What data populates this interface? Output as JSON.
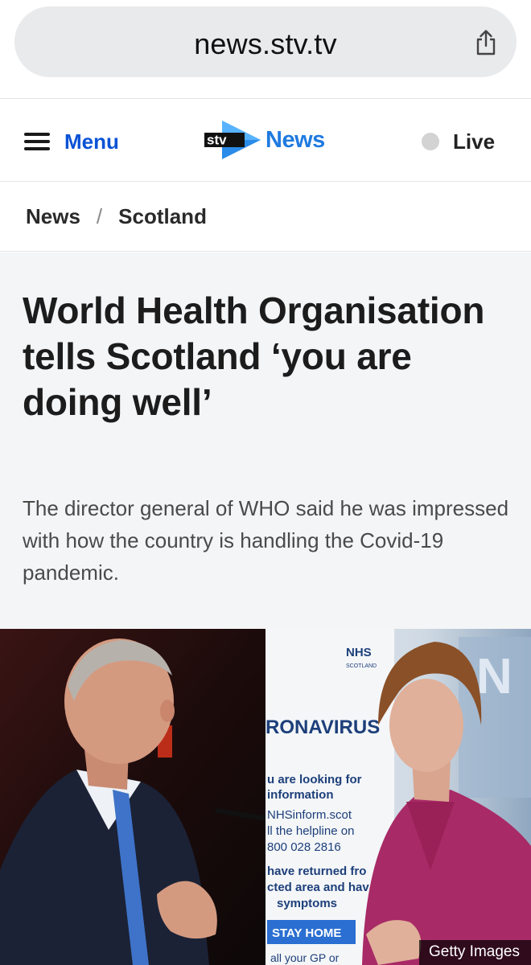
{
  "browser": {
    "url": "news.stv.tv",
    "share_icon": "share-icon"
  },
  "header": {
    "menu_label": "Menu",
    "logo_stv": "stv",
    "logo_news": "News",
    "live_label": "Live"
  },
  "breadcrumb": {
    "items": [
      "News",
      "Scotland"
    ],
    "separator": "/"
  },
  "article": {
    "headline": "World Health Organisation tells Scotland ‘you are doing well’",
    "standfirst": "The director general of WHO said he was impressed with how the country is handling the Covid-19 pandemic."
  },
  "image": {
    "credit": "Getty Images",
    "sign": {
      "nhs": "NHS",
      "nhs_sub": "SCOTLAND",
      "title": "RONAVIRUS",
      "lines": [
        "u are looking for",
        "information",
        "NHSinform.scot",
        "ll the helpline on",
        "800 028 2816",
        "have returned fro",
        "cted area and hav",
        "symptoms",
        "STAY HOME",
        "all your GP or"
      ]
    }
  },
  "colors": {
    "menu_blue": "#0a52d6",
    "news_blue": "#1f7ae0",
    "article_bg": "#f4f5f7",
    "live_dot": "#d3d3d3"
  }
}
